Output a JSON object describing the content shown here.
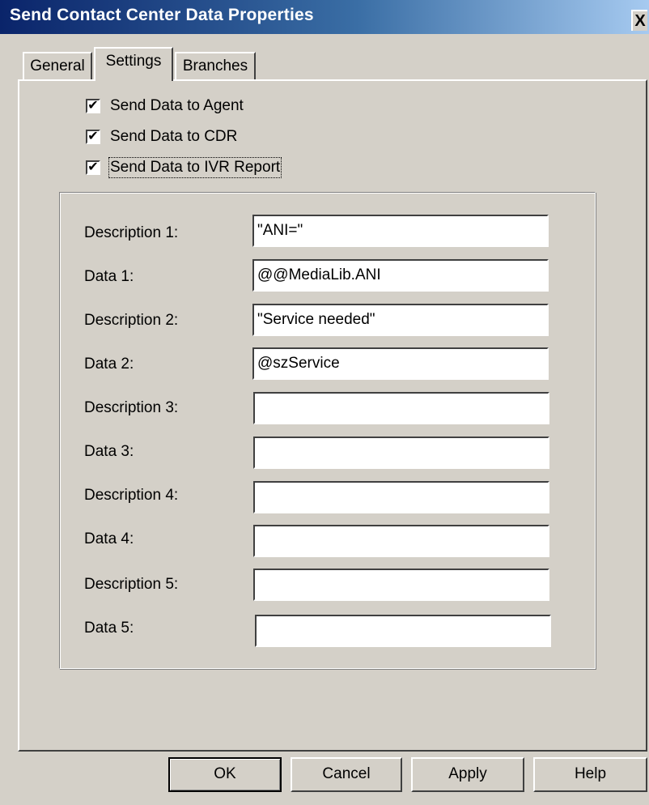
{
  "window": {
    "title": "Send Contact Center Data Properties",
    "close_label": "X"
  },
  "tabs": [
    {
      "label": "General",
      "active": false
    },
    {
      "label": "Settings",
      "active": true
    },
    {
      "label": "Branches",
      "active": false
    }
  ],
  "checkboxes": [
    {
      "label": "Send Data to Agent",
      "checked": true
    },
    {
      "label": "Send Data to CDR",
      "checked": true
    },
    {
      "label": "Send Data to IVR Report",
      "checked": true
    }
  ],
  "check_mark": "✔",
  "fields": [
    {
      "label": "Description 1:",
      "value": "\"ANI=\""
    },
    {
      "label": "Data 1:",
      "value": "@@MediaLib.ANI"
    },
    {
      "label": "Description 2:",
      "value": "\"Service needed\""
    },
    {
      "label": "Data 2:",
      "value": "@szService"
    },
    {
      "label": "Description 3:",
      "value": ""
    },
    {
      "label": "Data 3:",
      "value": ""
    },
    {
      "label": "Description 4:",
      "value": ""
    },
    {
      "label": "Data 4:",
      "value": ""
    },
    {
      "label": "Description 5:",
      "value": ""
    },
    {
      "label": "Data 5:",
      "value": ""
    }
  ],
  "buttons": {
    "ok": "OK",
    "cancel": "Cancel",
    "apply": "Apply",
    "help": "Help"
  }
}
